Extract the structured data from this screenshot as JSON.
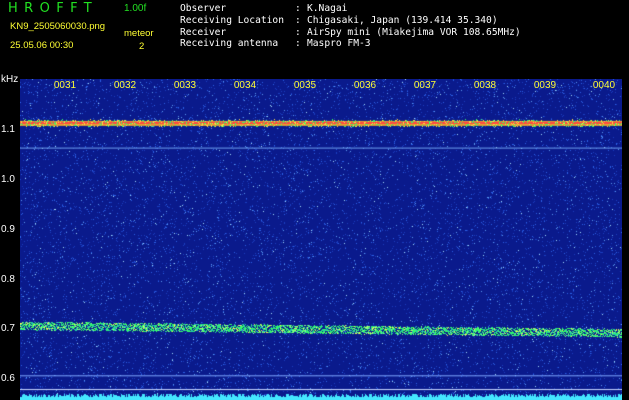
{
  "header": {
    "app_name": "HROFFT",
    "version": "1.00f",
    "filename": "KN9_2505060030.png",
    "datetime": "25.05.06 00:30",
    "meteor_label": "meteor",
    "meteor_count": "2"
  },
  "info": [
    {
      "label": "Observer",
      "value": "K.Nagai"
    },
    {
      "label": "Receiving Location",
      "value": "Chigasaki, Japan (139.414 35.340)"
    },
    {
      "label": "Receiver",
      "value": "AirSpy mini (Miakejima VOR 108.65MHz)"
    },
    {
      "label": "Receiving antenna",
      "value": "Maspro FM-3"
    }
  ],
  "spectrogram": {
    "y_unit": "kHz",
    "y_ticks": [
      "1.1",
      "1.0",
      "0.9",
      "0.8",
      "0.7",
      "0.6"
    ],
    "y_range": [
      0.575,
      1.16
    ],
    "time_labels": [
      "0031",
      "0032",
      "0033",
      "0034",
      "0035",
      "0036",
      "0037",
      "0038",
      "0039",
      "0040"
    ],
    "carrier_line_khz": 1.08,
    "secondary_line_khz": 0.71,
    "colors": {
      "background": "#0a1a8c",
      "carrier": "#ff4444",
      "band": "#33ff66",
      "text_yellow": "#ffff33",
      "app_green": "#22e022"
    }
  }
}
